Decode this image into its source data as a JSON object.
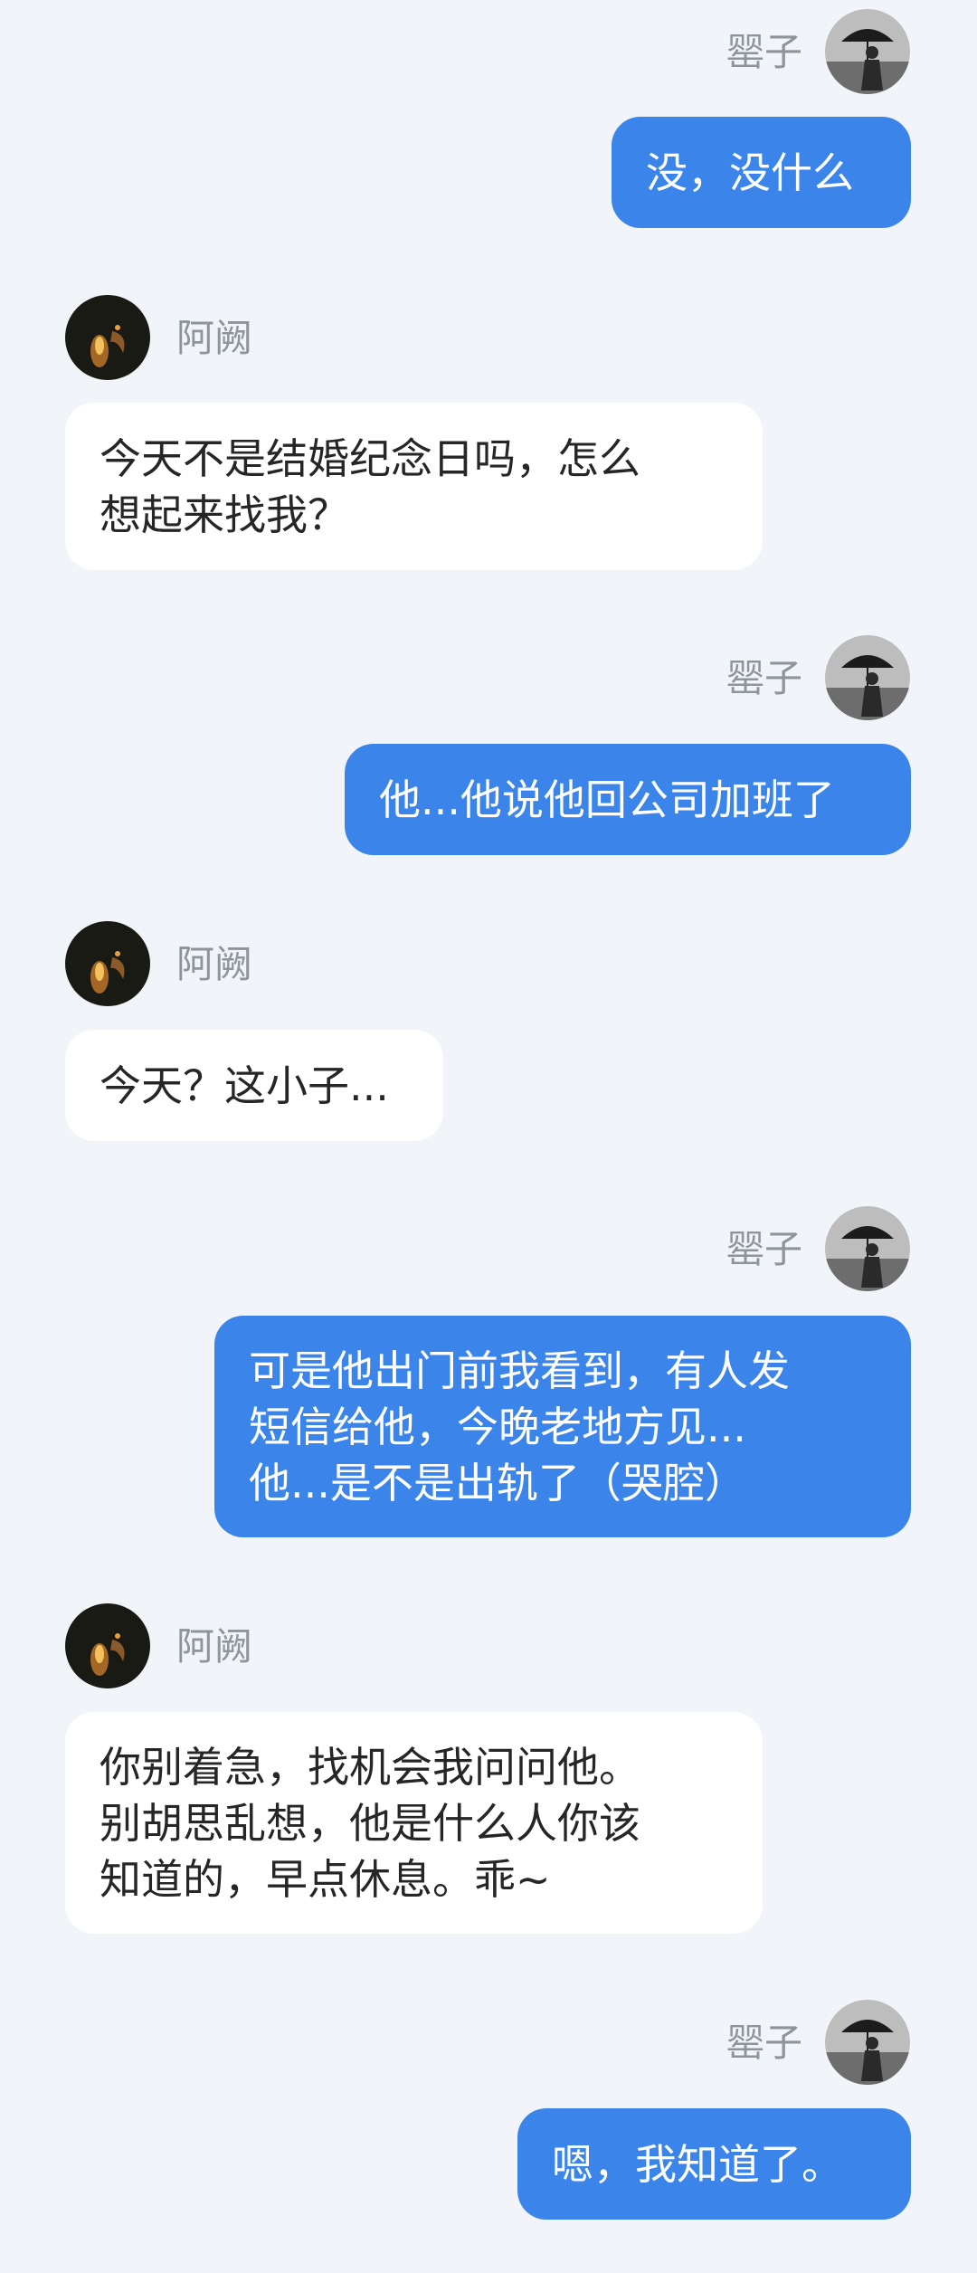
{
  "participants": {
    "me": {
      "name": "罂子",
      "avatar_icon": "umbrella-woman-avatar-icon"
    },
    "them": {
      "name": "阿阙",
      "avatar_icon": "candle-flame-avatar-icon"
    }
  },
  "colors": {
    "background": "#f1f4f9",
    "my_bubble": "#3b84ea",
    "their_bubble": "#ffffff",
    "name_text": "#8e949c"
  },
  "messages": [
    {
      "sender": "me",
      "text": "没，没什么"
    },
    {
      "sender": "them",
      "text": "今天不是结婚纪念日吗，怎么\n想起来找我？"
    },
    {
      "sender": "me",
      "text": "他...他说他回公司加班了"
    },
    {
      "sender": "them",
      "text": "今天？这小子..."
    },
    {
      "sender": "me",
      "text": "可是他出门前我看到，有人发\n短信给他，今晚老地方见...\n他...是不是出轨了（哭腔）"
    },
    {
      "sender": "them",
      "text": "你别着急，找机会我问问他。\n别胡思乱想，他是什么人你该\n知道的，早点休息。乖~"
    },
    {
      "sender": "me",
      "text": "嗯，我知道了。"
    }
  ]
}
